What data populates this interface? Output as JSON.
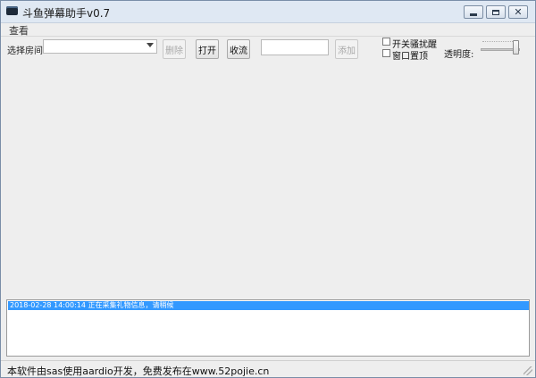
{
  "window": {
    "title": "斗鱼弹幕助手v0.7"
  },
  "menu": {
    "items": [
      "查看"
    ]
  },
  "toolbar": {
    "room_label": "选择房间:",
    "room_value": "",
    "delete_label": "删除",
    "open_label": "打开",
    "collect_label": "收流",
    "input_value": "",
    "add_label": "添加",
    "checkbox_reminder_label": "开关骚扰醒",
    "checkbox_reminder_checked": false,
    "checkbox_topmost_label": "窗口置顶",
    "checkbox_topmost_checked": false,
    "opacity_label": "透明度:",
    "opacity_level": 1.0
  },
  "log": {
    "entries": [
      {
        "text": "2018-02-28 14:00:14 正在采集礼物信息，请稍候",
        "selected": true
      }
    ]
  },
  "status": {
    "text": "本软件由sas使用aardio开发，免费发布在www.52pojie.cn"
  },
  "colors": {
    "selection": "#3399ff",
    "titlebar": "#dfe8f3"
  }
}
